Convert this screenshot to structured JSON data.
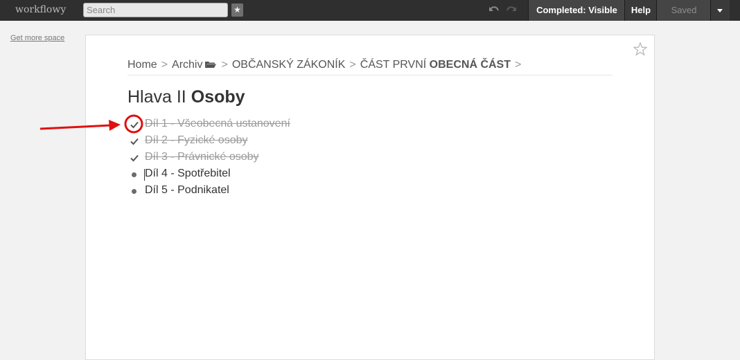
{
  "topbar": {
    "logo": "workflowy",
    "search_placeholder": "Search",
    "completed_label": "Completed: Visible",
    "help_label": "Help",
    "saved_label": "Saved"
  },
  "sidebar": {
    "more_space_link": "Get more space"
  },
  "breadcrumb": [
    {
      "label": "Home",
      "bold": false
    },
    {
      "label": "Archiv",
      "bold": false
    },
    {
      "label": "OBČANSKÝ ZÁKONÍK",
      "bold": false
    },
    {
      "label": "ČÁST PRVNÍ",
      "bold_part": "OBECNÁ ČÁST"
    }
  ],
  "title": {
    "normal": "Hlava II",
    "bold": "Osoby"
  },
  "items": [
    {
      "text": "Díl 1 - Všeobecná ustanovení",
      "completed": true
    },
    {
      "text": "Díl 2 - Fyzické osoby",
      "completed": true
    },
    {
      "text": "Díl 3 - Právnické osoby",
      "completed": true
    },
    {
      "text": "Díl 4 - Spotřebitel",
      "completed": false
    },
    {
      "text": "Díl 5 - Podnikatel",
      "completed": false
    }
  ],
  "colors": {
    "topbar": "#2f2f2f",
    "annotation": "#e01010"
  }
}
